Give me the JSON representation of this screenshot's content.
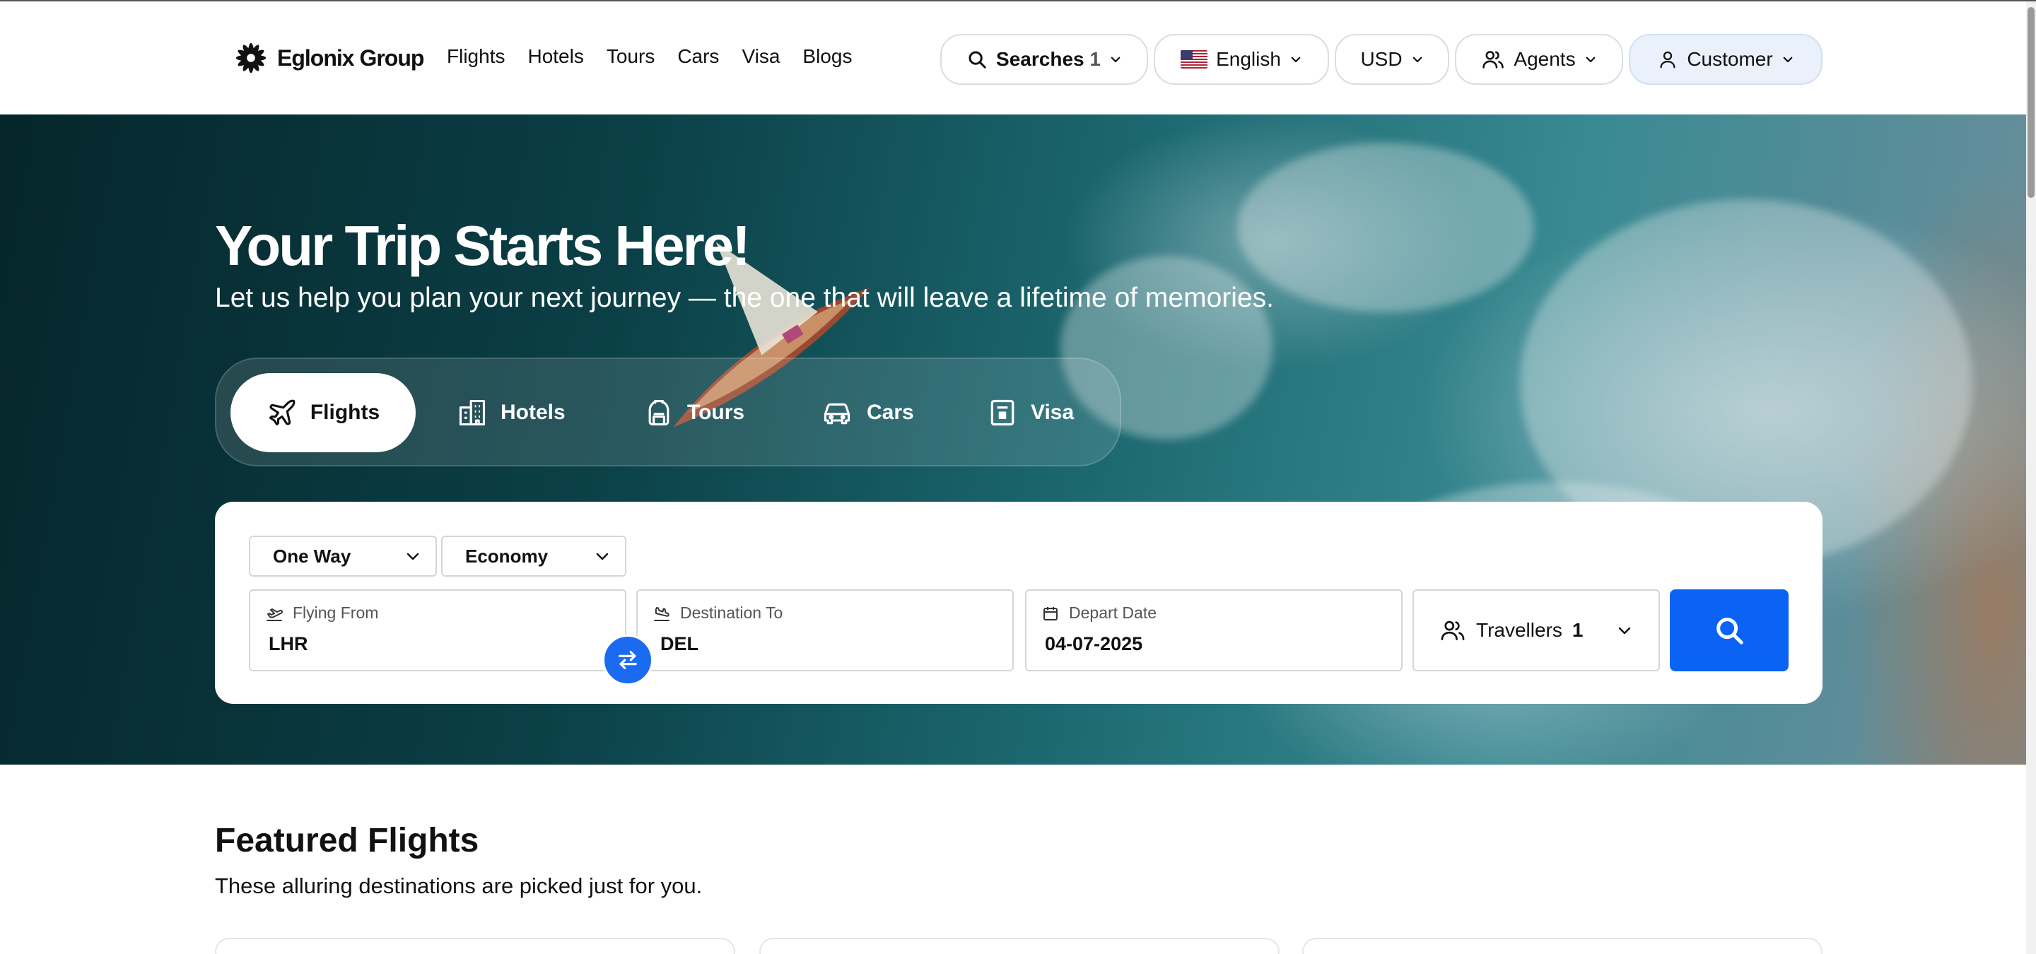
{
  "header": {
    "brand": "Eglonix Group",
    "nav": [
      "Flights",
      "Hotels",
      "Tours",
      "Cars",
      "Visa",
      "Blogs"
    ],
    "searches_label": "Searches",
    "searches_count": "1",
    "language": "English",
    "currency": "USD",
    "agents": "Agents",
    "customer": "Customer"
  },
  "hero": {
    "title": "Your Trip Starts Here!",
    "subtitle": "Let us help you plan your next journey — the one that will leave a lifetime of memories.",
    "tabs": [
      {
        "label": "Flights",
        "icon": "plane-icon"
      },
      {
        "label": "Hotels",
        "icon": "building-icon"
      },
      {
        "label": "Tours",
        "icon": "backpack-icon"
      },
      {
        "label": "Cars",
        "icon": "car-icon"
      },
      {
        "label": "Visa",
        "icon": "passport-icon"
      }
    ]
  },
  "search": {
    "trip_type": "One Way",
    "cabin_class": "Economy",
    "from_label": "Flying From",
    "from_value": "LHR",
    "to_label": "Destination To",
    "to_value": "DEL",
    "date_label": "Depart Date",
    "date_value": "04-07-2025",
    "travellers_label": "Travellers",
    "travellers_count": "1"
  },
  "featured": {
    "title": "Featured Flights",
    "subtitle": "These alluring destinations are picked just for you."
  },
  "colors": {
    "primary": "#0b63f6",
    "swap": "#1a6bf0",
    "customer_bg": "#eaf1fb"
  }
}
